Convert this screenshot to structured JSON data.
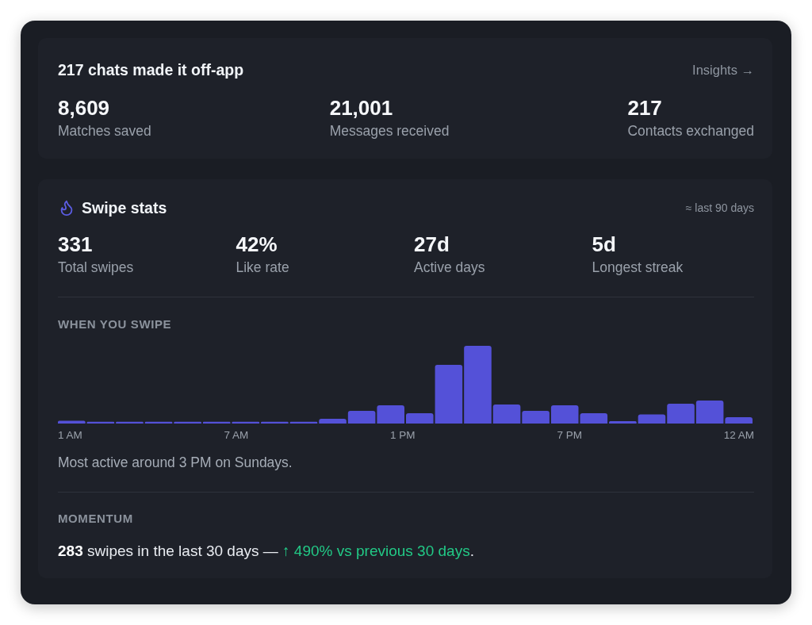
{
  "summary_card": {
    "title": "217 chats made it off-app",
    "link": "Insights →",
    "stats": [
      {
        "value": "8,609",
        "label": "Matches saved"
      },
      {
        "value": "21,001",
        "label": "Messages received"
      },
      {
        "value": "217",
        "label": "Contacts exchanged"
      }
    ]
  },
  "swipe_stats": {
    "title": "Swipe stats",
    "period": "≈ last 90 days",
    "stats": [
      {
        "value": "331",
        "label": "Total swipes"
      },
      {
        "value": "42%",
        "label": "Like rate"
      },
      {
        "value": "27d",
        "label": "Active days"
      },
      {
        "value": "5d",
        "label": "Longest streak"
      }
    ],
    "activity": {
      "heading": "WHEN YOU SWIPE",
      "axis_labels": [
        "1 AM",
        "7 AM",
        "1 PM",
        "7 PM",
        "12 AM"
      ],
      "note": "Most active around 3 PM on Sundays."
    },
    "momentum": {
      "heading": "MOMENTUM",
      "summary": "**283** swipes in the last 30 days —",
      "change": "↑ 490% vs previous 30 days",
      "positive": true,
      "end": "."
    }
  }
}
